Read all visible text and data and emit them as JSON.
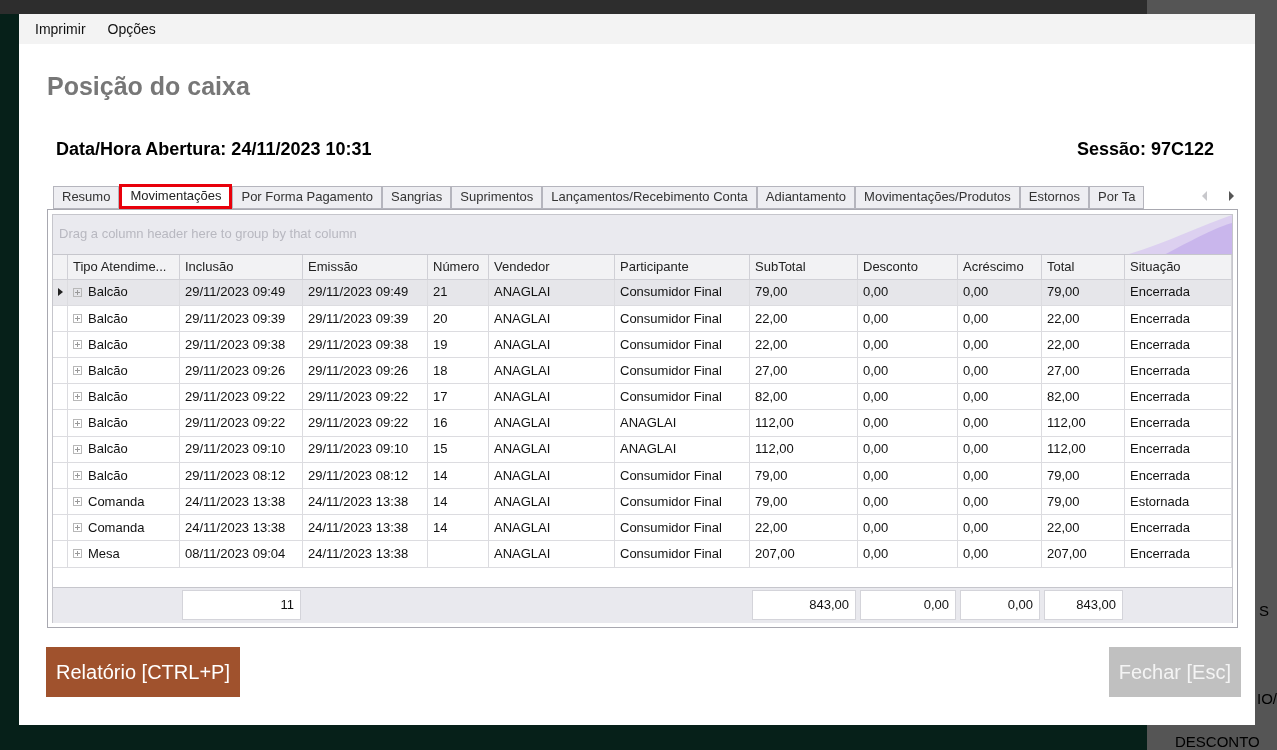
{
  "menu": [
    "Imprimir",
    "Opções"
  ],
  "title": "Posição do caixa",
  "opening": "Data/Hora Abertura: 24/11/2023 10:31",
  "session": "Sessão: 97C122",
  "tabs": [
    {
      "label": "Resumo",
      "selected": false
    },
    {
      "label": "Movimentações",
      "selected": true
    },
    {
      "label": "Por Forma Pagamento",
      "selected": false
    },
    {
      "label": "Sangrias",
      "selected": false
    },
    {
      "label": "Suprimentos",
      "selected": false
    },
    {
      "label": "Lançamentos/Recebimento Conta",
      "selected": false
    },
    {
      "label": "Adiantamento",
      "selected": false
    },
    {
      "label": "Movimentações/Produtos",
      "selected": false
    },
    {
      "label": "Estornos",
      "selected": false
    },
    {
      "label": "Por Ta",
      "selected": false
    }
  ],
  "group_panel_hint": "Drag a column header here to group by that column",
  "columns": [
    {
      "label": "Tipo Atendime..."
    },
    {
      "label": "Inclusão",
      "summary": "11"
    },
    {
      "label": "Emissão"
    },
    {
      "label": "Número"
    },
    {
      "label": "Vendedor"
    },
    {
      "label": "Participante"
    },
    {
      "label": "SubTotal",
      "summary": "843,00"
    },
    {
      "label": "Desconto",
      "summary": "0,00"
    },
    {
      "label": "Acréscimo",
      "summary": "0,00"
    },
    {
      "label": "Total",
      "summary": "843,00"
    },
    {
      "label": "Situação"
    }
  ],
  "rows": [
    {
      "selected": true,
      "cells": [
        "Balcão",
        "29/11/2023 09:49",
        "29/11/2023 09:49",
        "21",
        "ANAGLAI",
        "Consumidor Final",
        "79,00",
        "0,00",
        "0,00",
        "79,00",
        "Encerrada"
      ]
    },
    {
      "selected": false,
      "cells": [
        "Balcão",
        "29/11/2023 09:39",
        "29/11/2023 09:39",
        "20",
        "ANAGLAI",
        "Consumidor Final",
        "22,00",
        "0,00",
        "0,00",
        "22,00",
        "Encerrada"
      ]
    },
    {
      "selected": false,
      "cells": [
        "Balcão",
        "29/11/2023 09:38",
        "29/11/2023 09:38",
        "19",
        "ANAGLAI",
        "Consumidor Final",
        "22,00",
        "0,00",
        "0,00",
        "22,00",
        "Encerrada"
      ]
    },
    {
      "selected": false,
      "cells": [
        "Balcão",
        "29/11/2023 09:26",
        "29/11/2023 09:26",
        "18",
        "ANAGLAI",
        "Consumidor Final",
        "27,00",
        "0,00",
        "0,00",
        "27,00",
        "Encerrada"
      ]
    },
    {
      "selected": false,
      "cells": [
        "Balcão",
        "29/11/2023 09:22",
        "29/11/2023 09:22",
        "17",
        "ANAGLAI",
        "Consumidor Final",
        "82,00",
        "0,00",
        "0,00",
        "82,00",
        "Encerrada"
      ]
    },
    {
      "selected": false,
      "cells": [
        "Balcão",
        "29/11/2023 09:22",
        "29/11/2023 09:22",
        "16",
        "ANAGLAI",
        "ANAGLAI",
        "112,00",
        "0,00",
        "0,00",
        "112,00",
        "Encerrada"
      ]
    },
    {
      "selected": false,
      "cells": [
        "Balcão",
        "29/11/2023 09:10",
        "29/11/2023 09:10",
        "15",
        "ANAGLAI",
        "ANAGLAI",
        "112,00",
        "0,00",
        "0,00",
        "112,00",
        "Encerrada"
      ]
    },
    {
      "selected": false,
      "cells": [
        "Balcão",
        "29/11/2023 08:12",
        "29/11/2023 08:12",
        "14",
        "ANAGLAI",
        "Consumidor Final",
        "79,00",
        "0,00",
        "0,00",
        "79,00",
        "Encerrada"
      ]
    },
    {
      "selected": false,
      "cells": [
        "Comanda",
        "24/11/2023 13:38",
        "24/11/2023 13:38",
        "14",
        "ANAGLAI",
        "Consumidor Final",
        "79,00",
        "0,00",
        "0,00",
        "79,00",
        "Estornada"
      ]
    },
    {
      "selected": false,
      "cells": [
        "Comanda",
        "24/11/2023 13:38",
        "24/11/2023 13:38",
        "14",
        "ANAGLAI",
        "Consumidor Final",
        "22,00",
        "0,00",
        "0,00",
        "22,00",
        "Encerrada"
      ]
    },
    {
      "selected": false,
      "cells": [
        "Mesa",
        "08/11/2023 09:04",
        "24/11/2023 13:38",
        null,
        "ANAGLAI",
        "Consumidor Final",
        "207,00",
        "0,00",
        "0,00",
        "207,00",
        "Encerrada"
      ]
    }
  ],
  "buttons": [
    {
      "label": "Relatório [CTRL+P]",
      "disabled": false
    },
    {
      "label": "Fechar [Esc]",
      "disabled": true
    }
  ],
  "background_texts": [
    "S",
    "IO/",
    "DESCONTO"
  ]
}
